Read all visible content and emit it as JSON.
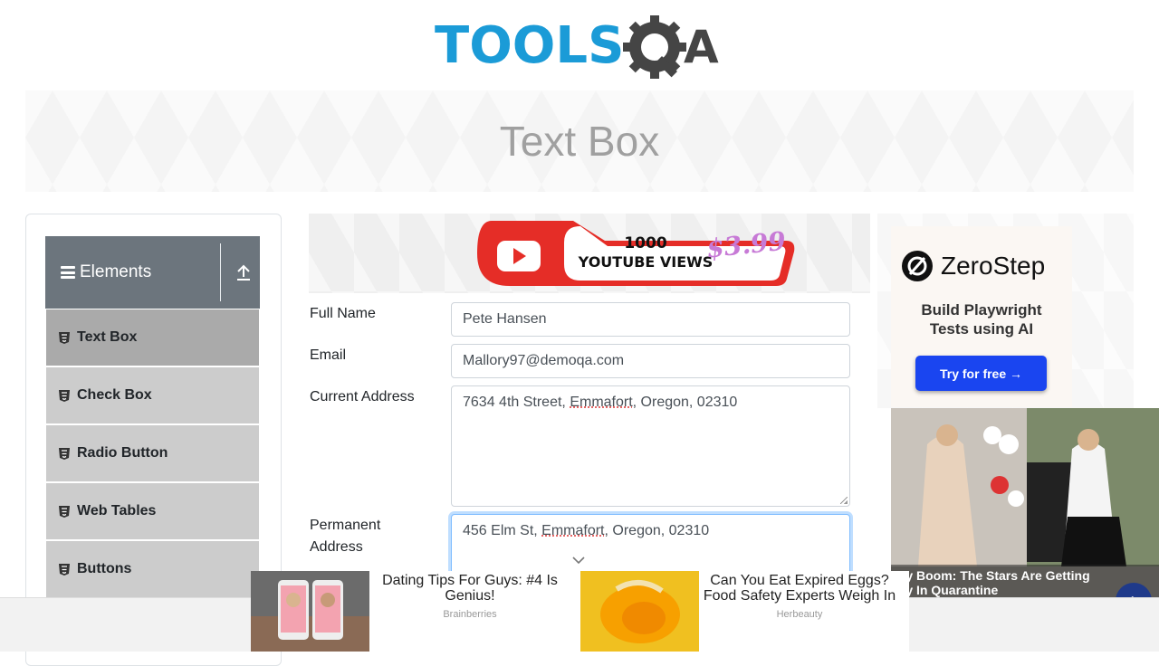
{
  "logo": {
    "text_main": "TOOLS",
    "text_end": "A",
    "alt": "ToolsQA"
  },
  "banner": {
    "title": "Text Box"
  },
  "sidebar": {
    "group_title": "Elements",
    "items": [
      {
        "label": "Text Box",
        "active": true
      },
      {
        "label": "Check Box",
        "active": false
      },
      {
        "label": "Radio Button",
        "active": false
      },
      {
        "label": "Web Tables",
        "active": false
      },
      {
        "label": "Buttons",
        "active": false
      }
    ]
  },
  "ad_top": {
    "line1": "1000",
    "line2": "YOUTUBE VIEWS",
    "price": "$3.99"
  },
  "form": {
    "full_name": {
      "label": "Full Name",
      "value": "Pete Hansen"
    },
    "email": {
      "label": "Email",
      "value": "Mallory97@demoqa.com"
    },
    "current_address": {
      "label": "Current Address",
      "value_pre": "7634 4th Street, ",
      "value_spell": "Emmafort",
      "value_post": ", Oregon, 02310"
    },
    "permanent_address": {
      "label_line1": "Permanent",
      "label_line2": "Address",
      "value_pre": "456 Elm St, ",
      "value_spell": "Emmafort",
      "value_post": ", Oregon, 02310"
    }
  },
  "right_ad": {
    "brand": "ZeroStep",
    "tagline_line1": "Build Playwright",
    "tagline_line2": "Tests using AI",
    "cta": "Try for free →",
    "accent": "#1a45f0"
  },
  "photo_ad": {
    "caption_line1": "aby Boom: The Stars Are Getting",
    "caption_line2": "usy In Quarantine",
    "next_icon": "›"
  },
  "bottom_ads": [
    {
      "headline": "Dating Tips For Guys: #4 Is Genius!",
      "source": "Brainberries"
    },
    {
      "headline": "Can You Eat Expired Eggs? Food Safety Experts Weigh In",
      "source": "Herbeauty"
    }
  ]
}
